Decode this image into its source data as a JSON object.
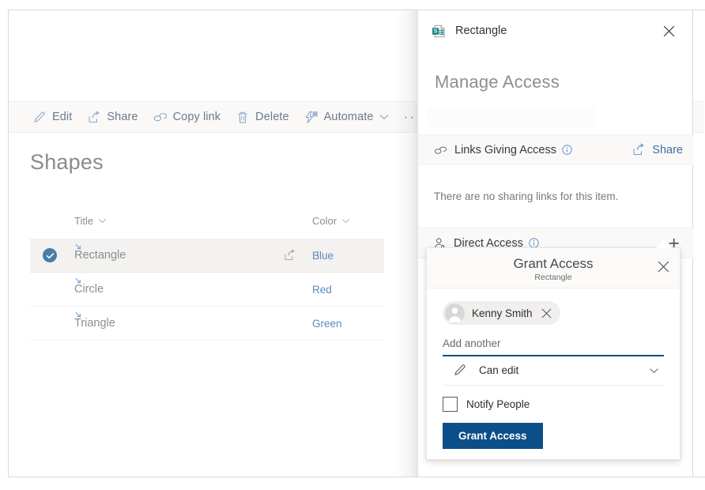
{
  "commandbar": {
    "items": [
      {
        "label": "Edit",
        "icon": "pencil-icon",
        "chevron": false
      },
      {
        "label": "Share",
        "icon": "share-icon",
        "chevron": false
      },
      {
        "label": "Copy link",
        "icon": "link-icon",
        "chevron": false
      },
      {
        "label": "Delete",
        "icon": "trash-icon",
        "chevron": false
      },
      {
        "label": "Automate",
        "icon": "automate-icon",
        "chevron": true
      }
    ],
    "overflow_label": "···"
  },
  "list": {
    "title": "Shapes",
    "columns": [
      {
        "label": "Title"
      },
      {
        "label": "Color"
      }
    ],
    "rows": [
      {
        "title": "Rectangle",
        "color": "Blue",
        "selected": true
      },
      {
        "title": "Circle",
        "color": "Red",
        "selected": false
      },
      {
        "title": "Triangle",
        "color": "Green",
        "selected": false
      }
    ]
  },
  "panel": {
    "item_title": "Rectangle",
    "item_icon": "sharepoint-list-item-icon",
    "close_label": "Close",
    "heading": "Manage Access",
    "links_section": {
      "label": "Links Giving Access",
      "icon": "link-icon",
      "info_icon": "info-icon",
      "action_label": "Share",
      "action_icon": "share-icon",
      "empty_text": "There are no sharing links for this item."
    },
    "direct_section": {
      "label": "Direct Access",
      "icon": "person-icon",
      "info_icon": "info-icon",
      "add_label": "+"
    }
  },
  "grant_dialog": {
    "title": "Grant Access",
    "subtitle": "Rectangle",
    "close_label": "Close",
    "recipients": [
      {
        "name": "Kenny Smith",
        "remove_label": "Remove"
      }
    ],
    "add_another_placeholder": "Add another",
    "permission": {
      "value": "Can edit",
      "icon": "pencil-icon",
      "chevron_icon": "chevron-down-icon"
    },
    "notify": {
      "label": "Notify People",
      "checked": false
    },
    "submit_label": "Grant Access"
  },
  "colors": {
    "accent_blue": "#0c4f88",
    "link_blue": "#3b6ea5",
    "value_blue": "#5b88bd",
    "selection_blue": "#4a7ca9",
    "panel_bg": "#ffffff",
    "section_bg": "#faf9f8",
    "sharepoint_teal": "#0b7c7c"
  }
}
